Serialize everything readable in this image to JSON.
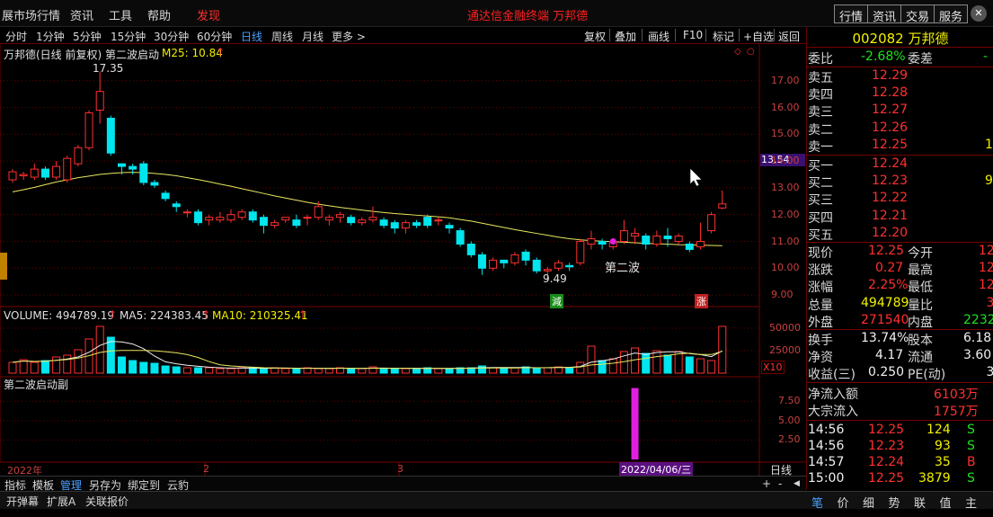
{
  "menu": {
    "items": [
      "展市场行情",
      "资讯",
      "工具",
      "帮助"
    ],
    "discover": "发现",
    "center_title": "通达信金融终端  万邦德",
    "right_buttons": [
      "行情",
      "资讯",
      "交易",
      "服务"
    ]
  },
  "periods": [
    "分时",
    "1分钟",
    "5分钟",
    "15分钟",
    "30分钟",
    "60分钟",
    "日线",
    "周线",
    "月线",
    "更多 >"
  ],
  "active_period": "日线",
  "tools": [
    "复权",
    "叠加",
    "画线",
    "F10",
    "标记",
    "+自选",
    "返回"
  ],
  "legend": {
    "title": "万邦德(日线 前复权) 第二波启动",
    "ma": "M25: 10.84",
    "volume": "VOLUME: 494789.19",
    "ma5": "MA5: 224383.45",
    "ma10": "MA10: 210325.41",
    "sub": "第二波启动副"
  },
  "annotations": {
    "high": "17.35",
    "low": "9.49",
    "wave": "第二波",
    "down_tag": "減",
    "up_tag": "涨",
    "price_tag": "13.54",
    "x10": "X10",
    "date_tag": "2022/04/06/三",
    "period_label": "日线"
  },
  "price_axis": [
    "17.00",
    "16.00",
    "15.00",
    "14.00",
    "13.00",
    "12.00",
    "11.00",
    "10.00",
    "9.00"
  ],
  "vol_axis": [
    "50000",
    "25000"
  ],
  "sub_axis": [
    "7.50",
    "5.00",
    "2.50"
  ],
  "date_axis": [
    "2022年",
    "2",
    "3"
  ],
  "chart_data": {
    "type": "candlestick",
    "ylim": [
      8.7,
      17.9
    ],
    "candles": [
      [
        13.3,
        13.6,
        13.2,
        13.7
      ],
      [
        13.45,
        13.5,
        13.3,
        13.6
      ],
      [
        13.4,
        13.7,
        13.3,
        13.9
      ],
      [
        13.7,
        13.4,
        13.3,
        13.8
      ],
      [
        13.4,
        13.8,
        13.3,
        14.0
      ],
      [
        13.3,
        14.1,
        13.2,
        14.2
      ],
      [
        13.9,
        14.5,
        13.8,
        14.6
      ],
      [
        14.5,
        15.8,
        14.4,
        15.9
      ],
      [
        15.9,
        16.6,
        15.4,
        17.35
      ],
      [
        15.6,
        14.3,
        14.2,
        15.7
      ],
      [
        13.9,
        13.8,
        13.5,
        13.9
      ],
      [
        13.8,
        13.7,
        13.5,
        13.9
      ],
      [
        13.9,
        13.2,
        13.1,
        14.0
      ],
      [
        13.2,
        13.1,
        13.0,
        13.3
      ],
      [
        12.8,
        12.6,
        12.5,
        12.9
      ],
      [
        12.4,
        12.3,
        12.1,
        12.5
      ],
      [
        12.1,
        12.1,
        11.9,
        12.2
      ],
      [
        12.1,
        11.7,
        11.6,
        12.2
      ],
      [
        11.8,
        11.9,
        11.6,
        12.0
      ],
      [
        11.8,
        11.9,
        11.7,
        12.1
      ],
      [
        11.8,
        12.0,
        11.7,
        12.2
      ],
      [
        11.9,
        12.1,
        11.8,
        12.2
      ],
      [
        12.1,
        11.8,
        11.7,
        12.2
      ],
      [
        11.9,
        11.6,
        11.3,
        12.0
      ],
      [
        11.6,
        11.7,
        11.5,
        11.8
      ],
      [
        11.8,
        11.9,
        11.7,
        11.9
      ],
      [
        11.8,
        11.6,
        11.5,
        12.0
      ],
      [
        11.9,
        11.9,
        11.6,
        12.0
      ],
      [
        11.9,
        12.3,
        11.8,
        12.5
      ],
      [
        11.8,
        11.9,
        11.6,
        12.0
      ],
      [
        11.9,
        12.0,
        11.7,
        12.1
      ],
      [
        11.9,
        11.7,
        11.6,
        12.0
      ],
      [
        11.7,
        11.8,
        11.6,
        11.9
      ],
      [
        11.8,
        11.9,
        11.7,
        12.3
      ],
      [
        11.8,
        11.6,
        11.5,
        11.9
      ],
      [
        11.7,
        11.5,
        11.3,
        11.8
      ],
      [
        11.5,
        11.7,
        11.3,
        11.8
      ],
      [
        11.7,
        11.6,
        11.5,
        11.8
      ],
      [
        11.9,
        11.6,
        11.5,
        12.0
      ],
      [
        11.8,
        11.8,
        11.6,
        11.9
      ],
      [
        11.6,
        11.5,
        11.3,
        11.7
      ],
      [
        11.4,
        10.9,
        10.8,
        11.5
      ],
      [
        10.9,
        10.5,
        10.4,
        11.0
      ],
      [
        10.5,
        10.0,
        9.75,
        10.6
      ],
      [
        10.0,
        10.3,
        9.9,
        10.4
      ],
      [
        10.3,
        10.2,
        10.0,
        10.3
      ],
      [
        10.2,
        10.5,
        10.1,
        10.6
      ],
      [
        10.6,
        10.3,
        10.1,
        10.7
      ],
      [
        10.3,
        9.9,
        9.8,
        10.4
      ],
      [
        9.9,
        9.95,
        9.49,
        10.05
      ],
      [
        10.0,
        10.2,
        9.9,
        10.3
      ],
      [
        10.1,
        10.05,
        9.9,
        10.2
      ],
      [
        10.2,
        11.0,
        10.1,
        11.1
      ],
      [
        10.9,
        11.1,
        10.7,
        11.4
      ],
      [
        11.0,
        10.9,
        10.7,
        11.1
      ],
      [
        10.8,
        11.0,
        10.7,
        11.1
      ],
      [
        11.0,
        11.4,
        10.9,
        11.8
      ],
      [
        11.2,
        11.3,
        10.9,
        11.5
      ],
      [
        11.2,
        10.9,
        10.7,
        11.3
      ],
      [
        10.9,
        11.2,
        10.8,
        11.4
      ],
      [
        11.2,
        11.1,
        10.8,
        11.5
      ],
      [
        11.0,
        11.2,
        10.9,
        11.3
      ],
      [
        10.9,
        10.7,
        10.6,
        11.0
      ],
      [
        10.8,
        11.0,
        10.7,
        11.7
      ],
      [
        11.4,
        12.0,
        11.3,
        12.1
      ],
      [
        12.25,
        12.4,
        12.2,
        12.9
      ]
    ],
    "ma25": [
      12.85,
      12.93,
      13.02,
      13.12,
      13.22,
      13.3,
      13.38,
      13.44,
      13.5,
      13.54,
      13.57,
      13.58,
      13.57,
      13.54,
      13.5,
      13.45,
      13.38,
      13.31,
      13.23,
      13.14,
      13.06,
      12.97,
      12.88,
      12.79,
      12.7,
      12.62,
      12.54,
      12.46,
      12.39,
      12.33,
      12.27,
      12.22,
      12.17,
      12.12,
      12.08,
      12.04,
      12.01,
      11.98,
      11.95,
      11.92,
      11.88,
      11.82,
      11.76,
      11.68,
      11.6,
      11.52,
      11.44,
      11.37,
      11.3,
      11.23,
      11.16,
      11.1,
      11.06,
      11.03,
      11.01,
      10.99,
      10.97,
      10.95,
      10.93,
      10.91,
      10.9,
      10.88,
      10.87,
      10.86,
      10.85,
      10.84
    ],
    "volume": [
      12000,
      15000,
      12000,
      14000,
      18000,
      20000,
      26000,
      38000,
      52000,
      40000,
      18000,
      14000,
      12000,
      11000,
      8000,
      7000,
      6000,
      6000,
      6000,
      5000,
      5000,
      6000,
      6000,
      5000,
      6000,
      5000,
      5000,
      6000,
      5000,
      5000,
      6000,
      5000,
      5000,
      7000,
      5000,
      5000,
      5000,
      5000,
      6000,
      5000,
      5000,
      6000,
      6000,
      8000,
      6000,
      5000,
      6000,
      7000,
      6000,
      6000,
      7000,
      6000,
      12000,
      30000,
      14000,
      16000,
      24000,
      28000,
      22000,
      25000,
      20000,
      24000,
      18000,
      16000,
      14000,
      52000
    ],
    "sub_bar": {
      "index": 57,
      "value": 9.2
    },
    "sub_ylim": [
      0,
      9.5
    ],
    "vol_ylim": [
      0,
      60000
    ]
  },
  "quote": {
    "code": "002082",
    "name": "万邦德",
    "webi_label": "委比",
    "webi": "-2.68%",
    "weicha_label": "委差",
    "weicha": "-",
    "asks": [
      {
        "label": "卖五",
        "price": "12.29",
        "vol": ""
      },
      {
        "label": "卖四",
        "price": "12.28",
        "vol": ""
      },
      {
        "label": "卖三",
        "price": "12.27",
        "vol": ""
      },
      {
        "label": "卖二",
        "price": "12.26",
        "vol": ""
      },
      {
        "label": "卖一",
        "price": "12.25",
        "vol": "1"
      }
    ],
    "bids": [
      {
        "label": "买一",
        "price": "12.24",
        "vol": ""
      },
      {
        "label": "买二",
        "price": "12.23",
        "vol": "9"
      },
      {
        "label": "买三",
        "price": "12.22",
        "vol": ""
      },
      {
        "label": "买四",
        "price": "12.21",
        "vol": ""
      },
      {
        "label": "买五",
        "price": "12.20",
        "vol": ""
      }
    ],
    "stats": [
      {
        "l1": "现价",
        "v1": "12.25",
        "c1": "#ff3030",
        "l2": "今开",
        "v2": "12",
        "c2": "#ff3030"
      },
      {
        "l1": "涨跌",
        "v1": "0.27",
        "c1": "#ff3030",
        "l2": "最高",
        "v2": "12",
        "c2": "#ff3030"
      },
      {
        "l1": "涨幅",
        "v1": "2.25%",
        "c1": "#ff3030",
        "l2": "最低",
        "v2": "12",
        "c2": "#ff3030"
      },
      {
        "l1": "总量",
        "v1": "494789",
        "c1": "#f0f000",
        "l2": "量比",
        "v2": "3",
        "c2": "#ff3030"
      },
      {
        "l1": "外盘",
        "v1": "271540",
        "c1": "#ff3030",
        "l2": "内盘",
        "v2": "2232",
        "c2": "#20e020"
      }
    ],
    "stats2": [
      {
        "l1": "换手",
        "v1": "13.74%",
        "l2": "股本",
        "v2": "6.18"
      },
      {
        "l1": "净资",
        "v1": "4.17",
        "l2": "流通",
        "v2": "3.60"
      },
      {
        "l1": "收益(三)",
        "v1": "0.250",
        "l2": "PE(动)",
        "v2": "3"
      }
    ],
    "flow": [
      {
        "label": "净流入额",
        "value": "6103万"
      },
      {
        "label": "大宗流入",
        "value": "1757万"
      }
    ],
    "ticks": [
      {
        "time": "14:56",
        "price": "12.25",
        "vol": "124",
        "side": "S"
      },
      {
        "time": "14:56",
        "price": "12.23",
        "vol": "93",
        "side": "S"
      },
      {
        "time": "14:57",
        "price": "12.24",
        "vol": "35",
        "side": "B"
      },
      {
        "time": "15:00",
        "price": "12.25",
        "vol": "3879",
        "side": "S"
      }
    ]
  },
  "bottom_tabs1": [
    "指标",
    "模板",
    "管理",
    "另存为",
    "绑定到",
    "云豹"
  ],
  "bottom_tabs2": [
    "开弹幕",
    "扩展A",
    "关联报价"
  ],
  "right_tabs": [
    "笔",
    "价",
    "细",
    "势",
    "联",
    "值",
    "主"
  ],
  "colors": {
    "up": "#ff3030",
    "down": "#00e5ee",
    "ma": "#e8e860",
    "grid": "#6a0000",
    "magenta": "#e020e0"
  }
}
